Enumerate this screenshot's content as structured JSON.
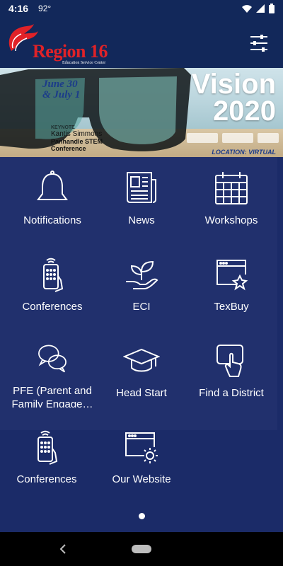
{
  "status_bar": {
    "time": "4:16",
    "temperature": "92°",
    "icons": [
      "wifi-icon",
      "signal-icon",
      "battery-icon"
    ]
  },
  "header": {
    "logo_text": "Region 16",
    "logo_subtitle": "Education Service Center",
    "menu_icon": "sliders-icon"
  },
  "banner": {
    "dates": "June 30\n& July 1",
    "keynote_label": "KEYNOTE",
    "keynote_name": "Kantis Simmons",
    "conference_line1": "Panhandle STEM",
    "conference_line2": "Conference",
    "vision_line1": "Vision",
    "vision_line2": "2020",
    "location": "LOCATION: VIRTUAL"
  },
  "tiles": [
    {
      "label": "Notifications",
      "icon": "bell-icon"
    },
    {
      "label": "News",
      "icon": "newspaper-icon"
    },
    {
      "label": "Workshops",
      "icon": "calendar-icon"
    },
    {
      "label": "Conferences",
      "icon": "phone-hand-icon"
    },
    {
      "label": "ECI",
      "icon": "plant-hand-icon"
    },
    {
      "label": "TexBuy",
      "icon": "browser-star-icon"
    },
    {
      "label": "PFE (Parent and Family Engage…",
      "icon": "chat-bubbles-icon"
    },
    {
      "label": "Head Start",
      "icon": "graduation-cap-icon"
    },
    {
      "label": "Find a District",
      "icon": "pointer-click-icon"
    },
    {
      "label": "Conferences",
      "icon": "phone-hand-icon"
    },
    {
      "label": "Our Website",
      "icon": "browser-gear-icon"
    }
  ],
  "colors": {
    "header_bg": "#12285a",
    "main_bg": "#1b2b68",
    "panel_bg": "#21306d",
    "logo_red": "#e02228"
  },
  "page_indicator": {
    "current": 1,
    "total": 1
  }
}
